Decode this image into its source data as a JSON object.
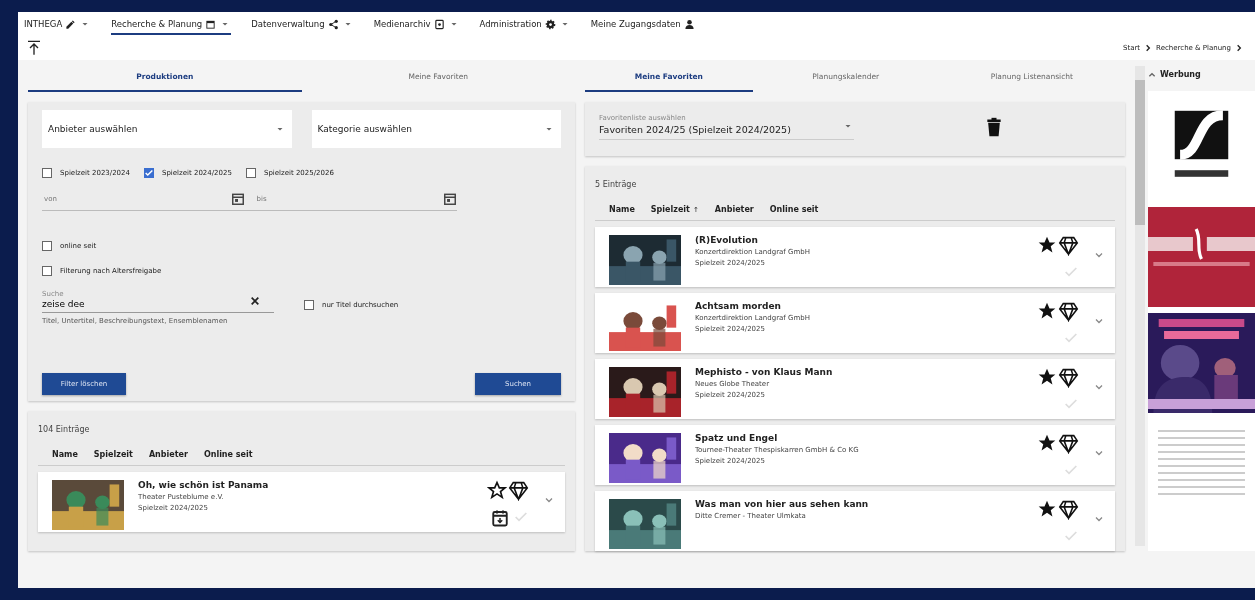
{
  "nav": [
    {
      "label": "INTHEGA",
      "kind": "menu",
      "selected": false
    },
    {
      "label": "Recherche & Planung",
      "kind": "menu",
      "selected": true
    },
    {
      "label": "Datenverwaltung",
      "kind": "menu",
      "selected": false
    },
    {
      "label": "Medienarchiv",
      "kind": "menu",
      "selected": false
    },
    {
      "label": "Administration",
      "kind": "menu",
      "selected": false
    },
    {
      "label": "Meine Zugangsdaten",
      "kind": "link",
      "selected": false
    }
  ],
  "breadcrumb": [
    "Start",
    "Recherche & Planung"
  ],
  "left": {
    "tabs": [
      {
        "label": "Produktionen",
        "selected": true
      },
      {
        "label": "Meine Favoriten",
        "selected": false
      }
    ],
    "filters": {
      "dropdowns": [
        "Anbieter auswählen",
        "Kategorie auswählen"
      ],
      "seasons": [
        {
          "label": "Spielzeit 2023/2024",
          "checked": false
        },
        {
          "label": "Spielzeit 2024/2025",
          "checked": true
        },
        {
          "label": "Spielzeit 2025/2026",
          "checked": false
        }
      ],
      "dates": [
        {
          "placeholder": "von"
        },
        {
          "placeholder": "bis"
        }
      ],
      "options": [
        {
          "label": "online seit",
          "checked": false
        },
        {
          "label": "Filterung nach Altersfreigabe",
          "checked": false
        }
      ],
      "search": {
        "label": "Suche",
        "value": "zeise dee",
        "hint": "Titel, Untertitel, Beschreibungstext, Ensemblenamen"
      },
      "title_only": {
        "label": "nur Titel durchsuchen",
        "checked": false
      },
      "buttons": [
        "Filter löschen",
        "Suchen"
      ]
    },
    "results": {
      "count": "104 Einträge",
      "columns": [
        {
          "label": "Name"
        },
        {
          "label": "Spielzeit"
        },
        {
          "label": "Anbieter"
        },
        {
          "label": "Online seit"
        }
      ],
      "rows": [
        {
          "title": "Oh, wie schön ist Panama",
          "provider": "Theater Pusteblume e.V.",
          "season": "Spielzeit 2024/2025",
          "starred": false,
          "calendar": true
        }
      ]
    }
  },
  "right": {
    "tabs": [
      {
        "label": "Meine Favoriten",
        "selected": true
      },
      {
        "label": "Planungskalender",
        "selected": false
      },
      {
        "label": "Planung Listenansicht",
        "selected": false
      }
    ],
    "list_select": {
      "label": "Favoritenliste auswählen",
      "value": "Favoriten 2024/25 (Spielzeit 2024/2025)"
    },
    "results": {
      "count": "5 Einträge",
      "columns": [
        {
          "label": "Name"
        },
        {
          "label": "Spielzeit",
          "sort": "↑"
        },
        {
          "label": "Anbieter"
        },
        {
          "label": "Online seit"
        }
      ],
      "rows": [
        {
          "title": "(R)Evolution",
          "provider": "Konzertdirektion Landgraf GmbH",
          "season": "Spielzeit 2024/2025",
          "starred": true,
          "calendar": false
        },
        {
          "title": "Achtsam morden",
          "provider": "Konzertdirektion Landgraf GmbH",
          "season": "Spielzeit 2024/2025",
          "starred": true,
          "calendar": false
        },
        {
          "title": "Mephisto - von Klaus Mann",
          "provider": "Neues Globe Theater",
          "season": "Spielzeit 2024/2025",
          "starred": true,
          "calendar": false
        },
        {
          "title": "Spatz und Engel",
          "provider": "Tournee-Theater Thespiskarren GmbH & Co KG",
          "season": "Spielzeit 2024/2025",
          "starred": true,
          "calendar": false
        },
        {
          "title": "Was man von hier aus sehen kann",
          "provider": "Ditte Cremer - Theater Ulmkata",
          "starred": true,
          "calendar": false
        }
      ]
    }
  },
  "ads": {
    "title": "Werbung"
  }
}
